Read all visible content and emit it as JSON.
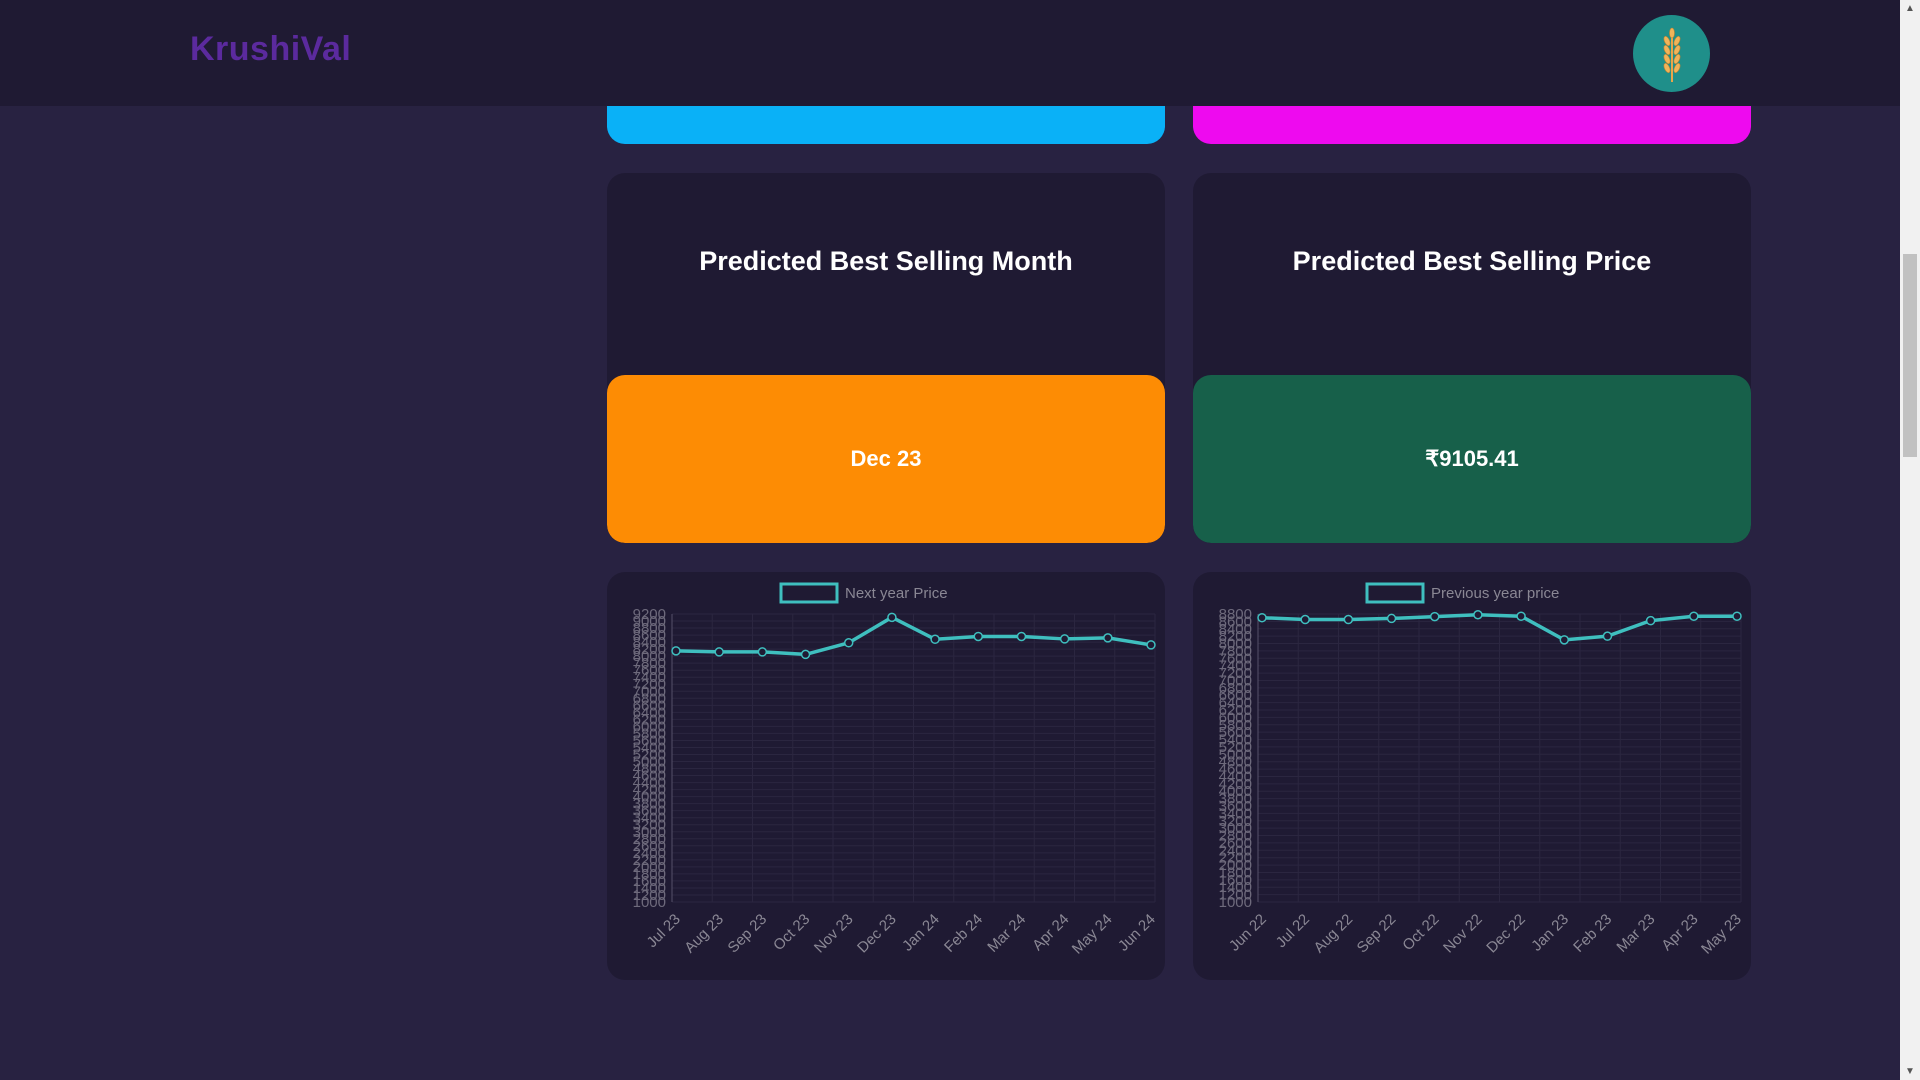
{
  "navbar": {
    "brand": "KrushiVal",
    "logo_icon": "wheat-icon"
  },
  "colors": {
    "top_strip_left": "#0ab1f7",
    "top_strip_right": "#ee0aef",
    "month_box": "#fd8c04",
    "price_box": "#17604a",
    "line": "#3fbfbf"
  },
  "cards": {
    "month": {
      "heading": "Predicted Best Selling Month",
      "value": "Dec 23"
    },
    "price": {
      "heading": "Predicted Best Selling Price",
      "value": "₹9105.41"
    }
  },
  "chart_data": [
    {
      "type": "line",
      "legend": "Next year Price",
      "legend_position": "top",
      "grid": true,
      "categories": [
        "Jul 23",
        "Aug 23",
        "Sep 23",
        "Oct 23",
        "Nov 23",
        "Dec 23",
        "Jan 24",
        "Feb 24",
        "Mar 24",
        "Apr 24",
        "May 24",
        "Jun 24"
      ],
      "values": [
        8150,
        8120,
        8120,
        8050,
        8380,
        9105,
        8480,
        8560,
        8560,
        8490,
        8520,
        8320
      ],
      "ylim": [
        1000,
        9200
      ],
      "yticks": [
        "1000",
        "1200",
        "1400",
        "1600",
        "1800",
        "2000",
        "2200",
        "2400",
        "2600",
        "2800",
        "3000",
        "3200",
        "3400",
        "3600",
        "3800",
        "4000",
        "4200",
        "4400",
        "4600",
        "4800",
        "5000",
        "5200",
        "5400",
        "5600",
        "5800",
        "6000",
        "6200",
        "6400",
        "6600",
        "6800",
        "7000",
        "7200",
        "7400",
        "7600",
        "7800",
        "8000",
        "8200",
        "8400",
        "8600",
        "8800",
        "9000",
        "9200"
      ]
    },
    {
      "type": "line",
      "legend": "Previous year price",
      "legend_position": "top",
      "grid": true,
      "categories": [
        "Jun 22",
        "Jul 22",
        "Aug 22",
        "Sep 22",
        "Oct 22",
        "Nov 22",
        "Dec 22",
        "Jan 23",
        "Feb 23",
        "Mar 23",
        "Apr 23",
        "May 23"
      ],
      "values": [
        8700,
        8650,
        8650,
        8680,
        8730,
        8780,
        8740,
        8100,
        8200,
        8620,
        8740,
        8740
      ],
      "ylim": [
        1000,
        8800
      ],
      "yticks": [
        "1000",
        "1200",
        "1400",
        "1600",
        "1800",
        "2000",
        "2200",
        "2400",
        "2600",
        "2800",
        "3000",
        "3200",
        "3400",
        "3600",
        "3800",
        "4000",
        "4200",
        "4400",
        "4600",
        "4800",
        "5000",
        "5200",
        "5400",
        "5600",
        "5800",
        "6000",
        "6200",
        "6400",
        "6600",
        "6800",
        "7000",
        "7200",
        "7400",
        "7600",
        "7800",
        "8000",
        "8200",
        "8400",
        "8600",
        "8800"
      ]
    }
  ]
}
